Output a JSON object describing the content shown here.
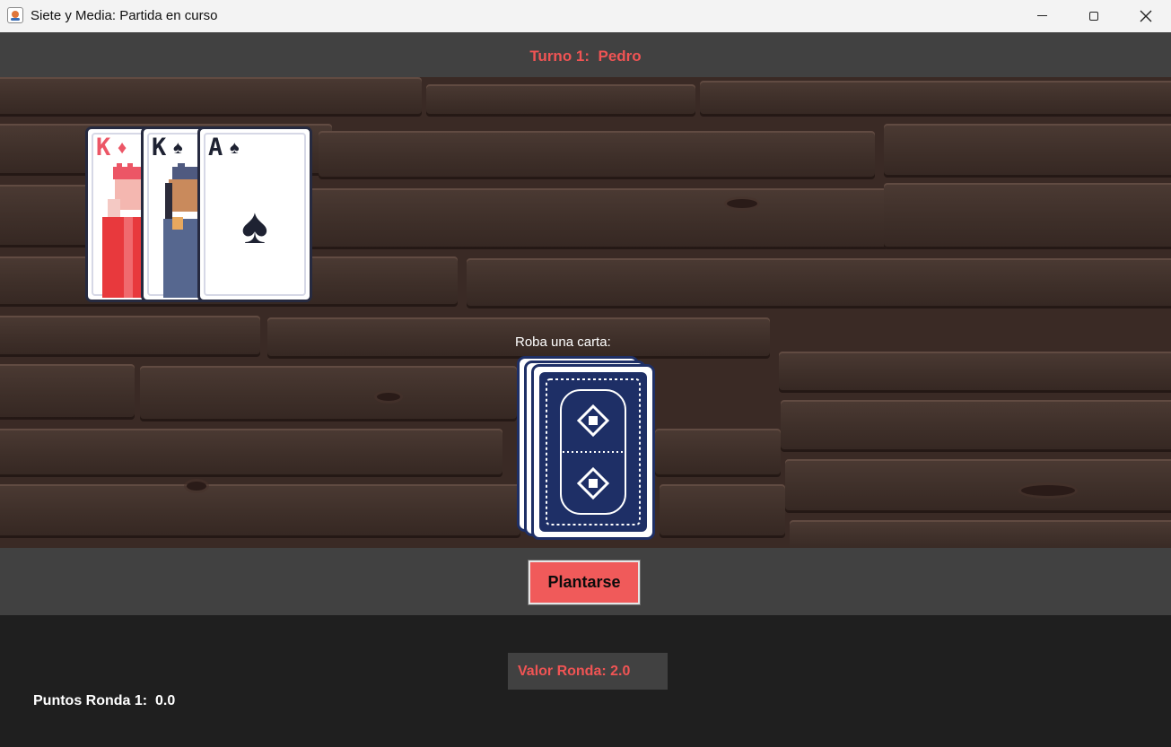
{
  "window": {
    "title": "Siete y Media: Partida en curso",
    "app_icon": "java-cup-icon",
    "controls": [
      "minimize-icon",
      "maximize-icon",
      "close-icon"
    ]
  },
  "header": {
    "turn": "Turno 1:  Pedro"
  },
  "hand": {
    "cards": [
      {
        "rank": "K",
        "suit": "♦",
        "suit_name": "diamonds",
        "color": "red"
      },
      {
        "rank": "K",
        "suit": "♠",
        "suit_name": "spades",
        "color": "black"
      },
      {
        "rank": "A",
        "suit": "♠",
        "suit_name": "spades",
        "color": "black"
      }
    ]
  },
  "deck": {
    "label": "Roba una carta:"
  },
  "actions": {
    "stand_label": "Plantarse"
  },
  "stats": {
    "round_value": "Valor Ronda: 2.0",
    "round_points": "Puntos Ronda 1:  0.0"
  },
  "colors": {
    "accent_red": "#f05454",
    "panel_gray": "#414141",
    "background_dark": "#1f1f1f",
    "card_back_navy": "#1e2f66"
  }
}
